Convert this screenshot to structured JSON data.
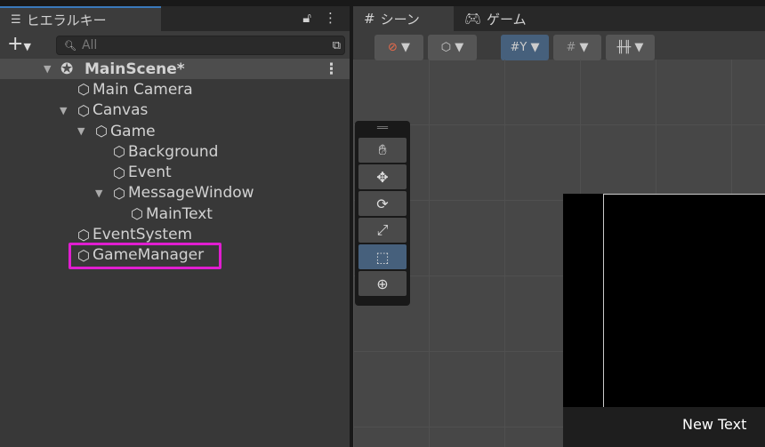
{
  "hierarchy": {
    "tab_label": "ヒエラルキー",
    "search_placeholder": "All",
    "scene": {
      "name": "MainScene*"
    },
    "items": [
      {
        "label": "Main Camera",
        "depth": 1,
        "expanded": null
      },
      {
        "label": "Canvas",
        "depth": 1,
        "expanded": true
      },
      {
        "label": "Game",
        "depth": 2,
        "expanded": true
      },
      {
        "label": "Background",
        "depth": 3,
        "expanded": null
      },
      {
        "label": "Event",
        "depth": 3,
        "expanded": null
      },
      {
        "label": "MessageWindow",
        "depth": 3,
        "expanded": true
      },
      {
        "label": "MainText",
        "depth": 4,
        "expanded": null
      },
      {
        "label": "EventSystem",
        "depth": 1,
        "expanded": null
      },
      {
        "label": "GameManager",
        "depth": 1,
        "expanded": null,
        "highlighted": true
      }
    ],
    "highlight_color": "#e01ed0"
  },
  "scene_view": {
    "tabs": [
      {
        "label": "シーン",
        "icon": "grid-icon",
        "active": true
      },
      {
        "label": "ゲーム",
        "icon": "gamepad-icon",
        "active": false
      }
    ],
    "tools": [
      "hand-tool",
      "move-tool",
      "rotate-tool",
      "scale-tool",
      "rect-tool",
      "transform-tool"
    ],
    "selected_tool": "rect-tool",
    "game_text": "New Text"
  }
}
